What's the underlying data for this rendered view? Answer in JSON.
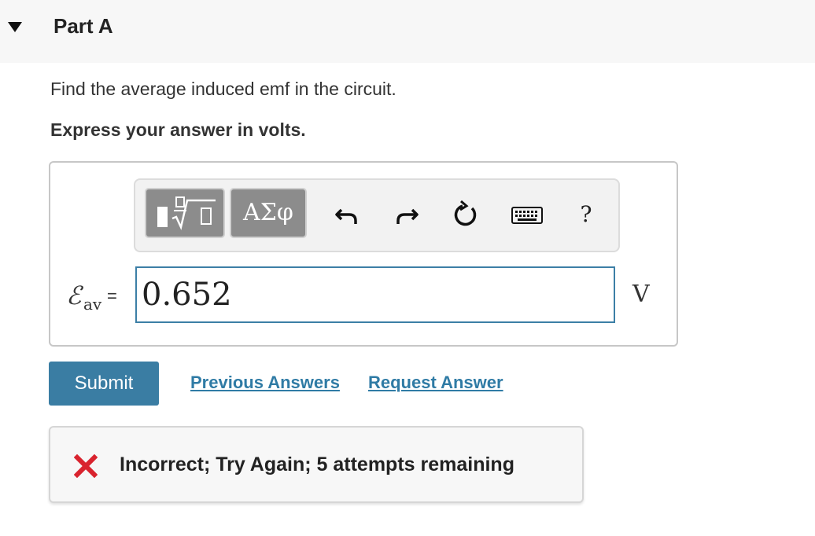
{
  "part": {
    "title": "Part A"
  },
  "question": {
    "text": "Find the average induced emf in the circuit.",
    "instruction": "Express your answer in volts."
  },
  "toolbar": {
    "templates_icon": "fraction-sqrt-template-icon",
    "greek_label": "ΑΣφ",
    "undo_icon": "undo-icon",
    "redo_icon": "redo-icon",
    "reset_icon": "reset-icon",
    "keyboard_icon": "keyboard-icon",
    "help_label": "?"
  },
  "answer": {
    "variable": "ℰ",
    "subscript": "av",
    "equals": "=",
    "value": "0.652",
    "unit": "V"
  },
  "actions": {
    "submit_label": "Submit",
    "previous_answers_label": "Previous Answers",
    "request_answer_label": "Request Answer"
  },
  "feedback": {
    "icon": "incorrect-x-icon",
    "text": "Incorrect; Try Again; 5 attempts remaining",
    "color": "#d9232e"
  },
  "colors": {
    "primary": "#3a7da3",
    "link": "#2f7ba5",
    "toolbar_button": "#8c8c8c",
    "input_border": "#3c7fa6"
  }
}
